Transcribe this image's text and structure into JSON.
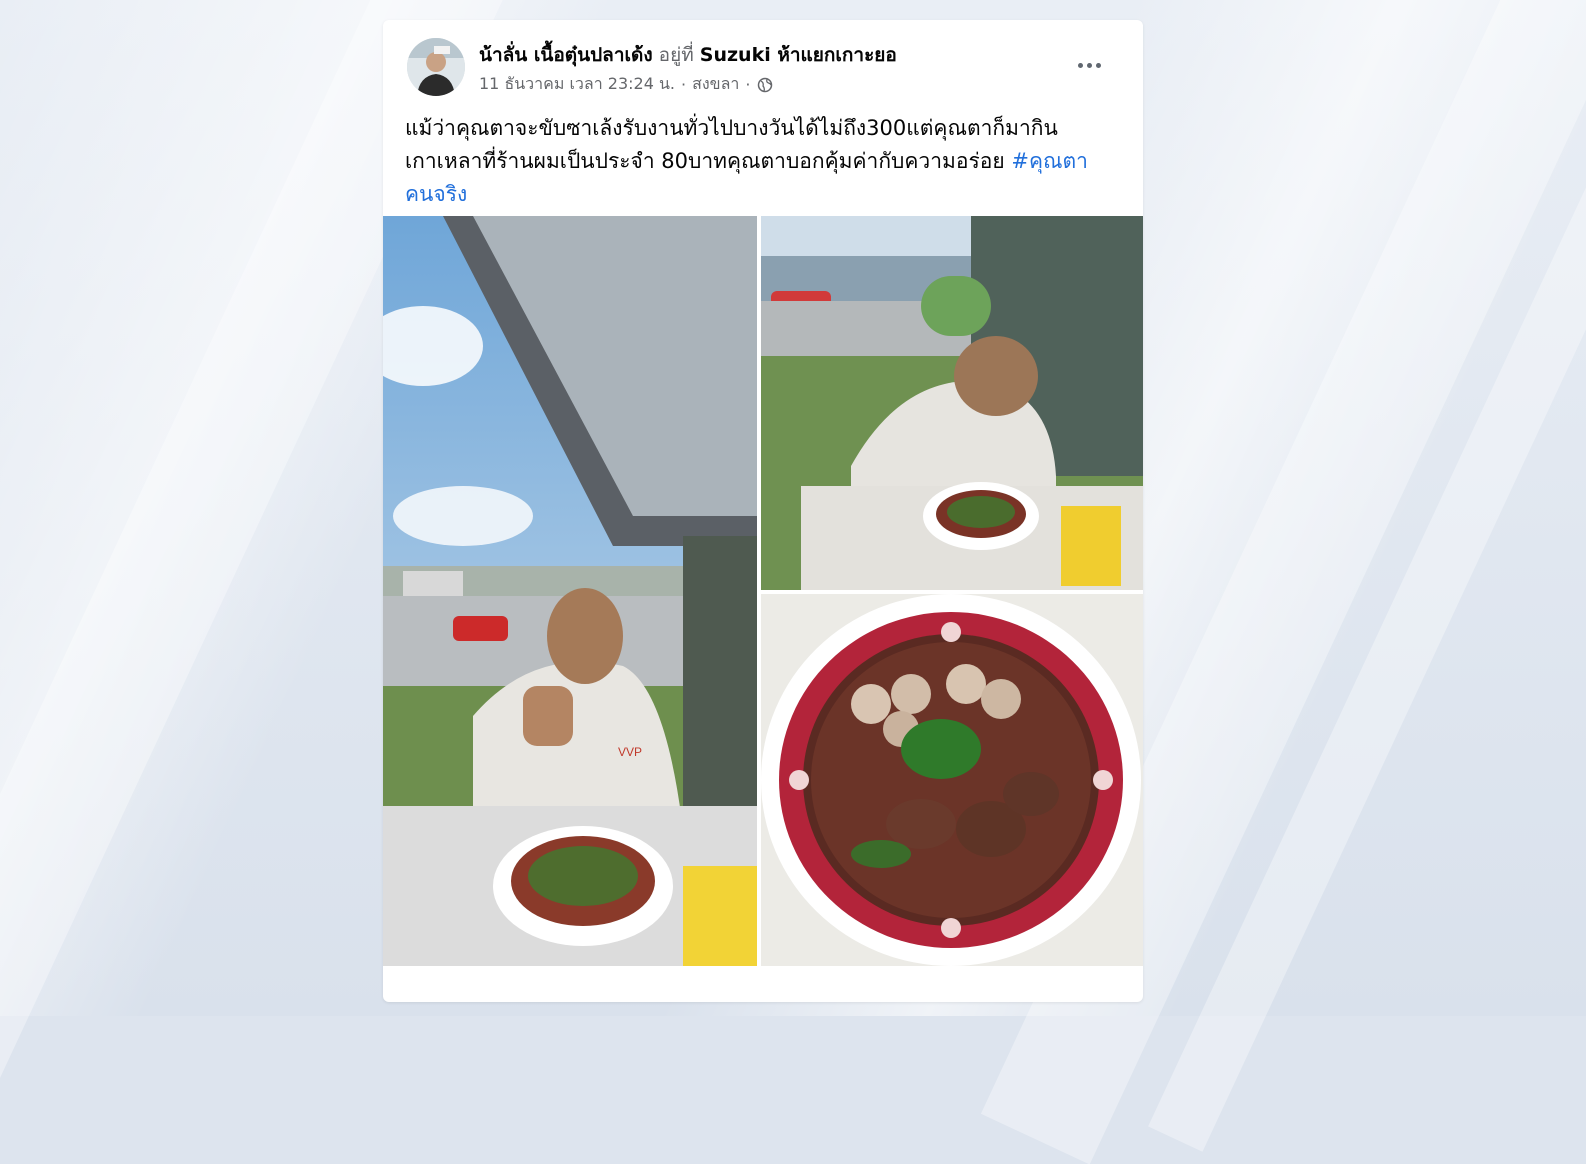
{
  "post": {
    "author_name": "น้าลั่น เนื้อตุ๋นปลาเด้ง",
    "location_prefix": "อยู่ที่",
    "location_name": "Suzuki ห้าแยกเกาะยอ",
    "timestamp": "11 ธันวาคม เวลา 23:24 น.",
    "separator": "·",
    "place": "สงขลา",
    "privacy_icon": "globe-icon",
    "more_icon": "more-options-icon",
    "text": "แม้ว่าคุณตาจะขับซาเล้งรับงานทั่วไปบางวันได้ไม่ถึง300แต่คุณตาก็มากินเกาเหลาที่ร้านผมเป็นประจำ 80บาทคุณตาบอกคุ้มค่ากับความอร่อย",
    "hashtag": "#คุณตาคนจริง",
    "photo_shirt_text": "VVP"
  }
}
